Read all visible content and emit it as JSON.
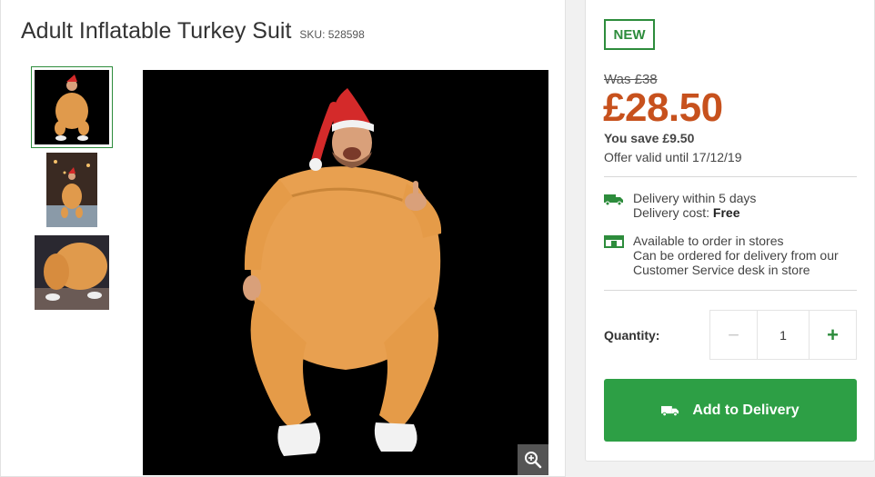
{
  "product": {
    "title": "Adult Inflatable Turkey Suit",
    "sku": "SKU: 528598"
  },
  "gallery": {
    "thumbnails": [
      "turkey-suit-front",
      "turkey-suit-outdoor",
      "turkey-suit-closeup"
    ],
    "zoom_icon": "zoom-in-icon"
  },
  "pricing": {
    "badge": "NEW",
    "was": "Was £38",
    "price": "£28.50",
    "save": "You save £9.50",
    "offer": "Offer valid until 17/12/19",
    "price_color": "#c7511d"
  },
  "delivery": {
    "icon": "truck-icon",
    "line1": "Delivery within 5 days",
    "cost_label": "Delivery cost: ",
    "cost_value": "Free"
  },
  "store": {
    "icon": "store-icon",
    "line1": "Available to order in stores",
    "line2": "Can be ordered for delivery from our",
    "line3": "Customer Service desk in store"
  },
  "quantity": {
    "label": "Quantity:",
    "value": "1",
    "minus": "−",
    "plus": "+"
  },
  "cta": {
    "label": "Add to Delivery",
    "icon": "truck-icon",
    "color": "#2d9f45"
  },
  "colors": {
    "accent_green": "#2d8c3c"
  }
}
